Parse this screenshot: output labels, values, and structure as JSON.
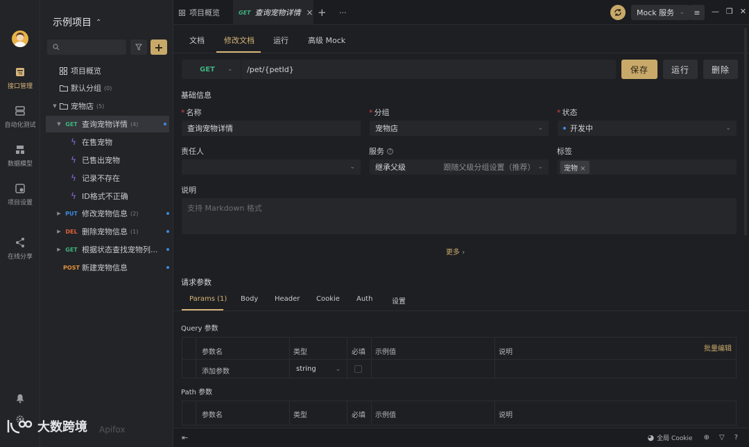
{
  "rail": {
    "items": [
      {
        "label": "接口管理",
        "icon": "api-icon",
        "active": true
      },
      {
        "label": "自动化测试",
        "icon": "test-icon"
      },
      {
        "label": "数据模型",
        "icon": "model-icon"
      },
      {
        "label": "项目设置",
        "icon": "settings-icon"
      },
      {
        "label": "在线分享",
        "icon": "share-icon"
      }
    ]
  },
  "sidebar": {
    "project_title": "示例项目",
    "tree": [
      {
        "label": "项目概览"
      },
      {
        "label": "默认分组",
        "count": "(0)"
      },
      {
        "label": "宠物店",
        "count": "(5)"
      },
      {
        "method": "GET",
        "label": "查询宠物详情",
        "count": "(4)"
      },
      {
        "label": "在售宠物"
      },
      {
        "label": "已售出宠物"
      },
      {
        "label": "记录不存在"
      },
      {
        "label": "ID格式不正确"
      },
      {
        "method": "PUT",
        "label": "修改宠物信息",
        "count": "(2)"
      },
      {
        "method": "DEL",
        "label": "删除宠物信息",
        "count": "(1)"
      },
      {
        "method": "GET",
        "label": "根据状态查找宠物列..."
      },
      {
        "method": "POST",
        "label": "新建宠物信息"
      }
    ]
  },
  "tabs": {
    "overview": "项目概览",
    "active_method": "GET",
    "active_label": "查询宠物详情"
  },
  "header": {
    "mock_service": "Mock 服务"
  },
  "main": {
    "subtabs": [
      "文档",
      "修改文档",
      "运行",
      "高级 Mock"
    ],
    "method": "GET",
    "path": "/pet/{petId}",
    "save": "保存",
    "run": "运行",
    "delete": "删除",
    "basic_info": "基础信息",
    "name_label": "名称",
    "name_value": "查询宠物详情",
    "group_label": "分组",
    "group_value": "宠物店",
    "status_label": "状态",
    "status_value": "开发中",
    "owner_label": "责任人",
    "service_label": "服务",
    "service_value": "继承父级",
    "service_hint": "跟随父级分组设置（推荐）",
    "tags_label": "标签",
    "tag_value": "宠物",
    "desc_label": "说明",
    "desc_placeholder": "支持 Markdown 格式",
    "more": "更多",
    "req_params": "请求参数",
    "param_tabs": [
      "Params (1)",
      "Body",
      "Header",
      "Cookie",
      "Auth",
      "设置"
    ],
    "query_title": "Query 参数",
    "cols": [
      "参数名",
      "类型",
      "必填",
      "示例值",
      "说明"
    ],
    "batch_edit": "批量编辑",
    "add_param_placeholder": "添加参数",
    "type_value": "string",
    "path_title": "Path 参数"
  },
  "statusbar": {
    "cookie": "全局 Cookie"
  },
  "watermark": {
    "text": "大数跨境",
    "brand": "Apifox"
  },
  "colors": {
    "accent": "#c8a96a",
    "get": "#3fb27f",
    "put": "#3c8ae0",
    "del": "#e0603c",
    "post": "#e0913c"
  }
}
